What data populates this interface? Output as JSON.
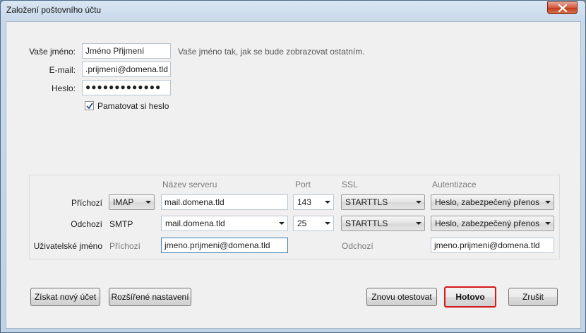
{
  "window": {
    "title": "Založení poštovního účtu"
  },
  "account": {
    "name_label": "Vaše jméno:",
    "name_value": "Jméno Přijmení",
    "name_hint": "Vaše jméno tak, jak se bude zobrazovat ostatním.",
    "email_label": "E-mail:",
    "email_value": ".prijmeni@domena.tld",
    "password_label": "Heslo:",
    "password_value": "●●●●●●●●●●●●●",
    "remember_label": "Pamatovat si heslo",
    "remember_checked": true
  },
  "server": {
    "headers": {
      "name": "Název serveru",
      "port": "Port",
      "ssl": "SSL",
      "auth": "Autentizace"
    },
    "incoming": {
      "label": "Příchozí",
      "protocol": "IMAP",
      "server": "mail.domena.tld",
      "port": "143",
      "ssl": "STARTTLS",
      "auth": "Heslo, zabezpečený přenos"
    },
    "outgoing": {
      "label": "Odchozí",
      "protocol": "SMTP",
      "server": "mail.domena.tld",
      "port": "25",
      "ssl": "STARTTLS",
      "auth": "Heslo, zabezpečený přenos"
    },
    "username": {
      "label": "Uživatelské jméno",
      "incoming_label": "Příchozí",
      "incoming_value": "jmeno.prijmeni@domena.tld",
      "outgoing_label": "Odchozí",
      "outgoing_value": "jmeno.prijmeni@domena.tld"
    }
  },
  "buttons": {
    "new_account": "Získat nový účet",
    "advanced": "Rozšířené nastavení",
    "retest": "Znovu otestovat",
    "done": "Hotovo",
    "cancel": "Zrušit"
  },
  "colors": {
    "default_button_border": "#d41a1a",
    "close_button": "#c23b1c"
  }
}
